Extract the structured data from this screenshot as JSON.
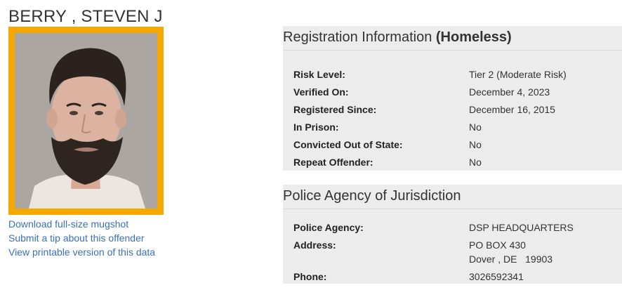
{
  "offender": {
    "name": "BERRY , STEVEN J"
  },
  "photo_links": {
    "download": "Download full-size mugshot",
    "tip": "Submit a tip about this offender",
    "printable": "View printable version of this data"
  },
  "registration": {
    "title": "Registration Information",
    "status": "(Homeless)",
    "rows": [
      {
        "label": "Risk Level:",
        "value": "Tier 2 (Moderate Risk)"
      },
      {
        "label": "Verified On:",
        "value": "December 4, 2023"
      },
      {
        "label": "Registered Since:",
        "value": "December 16, 2015"
      },
      {
        "label": "In Prison:",
        "value": "No"
      },
      {
        "label": "Convicted Out of State:",
        "value": "No"
      },
      {
        "label": "Repeat Offender:",
        "value": "No"
      }
    ]
  },
  "agency": {
    "title": "Police Agency of Jurisdiction",
    "agency_label": "Police Agency:",
    "agency_value": "DSP HEADQUARTERS",
    "address_label": "Address:",
    "address_line1": "PO BOX 430",
    "address_line2": "Dover , DE   19903",
    "phone_label": "Phone:",
    "phone_value": "3026592341"
  },
  "colors": {
    "mugshot_frame": "#f5a800",
    "link": "#3a71b5",
    "panel_bg": "#ececec"
  }
}
